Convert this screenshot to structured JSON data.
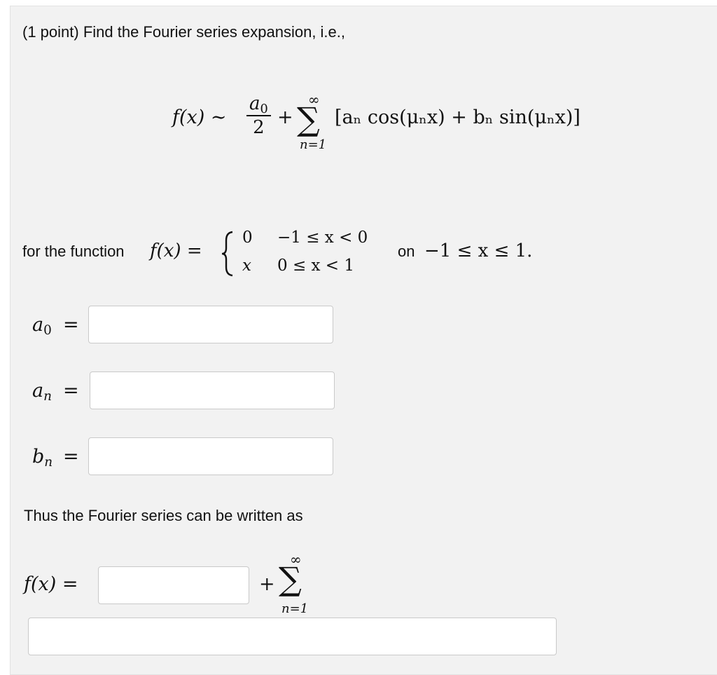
{
  "intro": "(1 point) Find the Fourier series expansion, i.e.,",
  "series_formula": {
    "lhs": "f(x) ∼",
    "frac_num": "a0",
    "frac_den": "2",
    "plus": "+",
    "sigma": "∑",
    "upper": "∞",
    "lower": "n=1",
    "term": "[aₙ cos(μₙx) + bₙ sin(μₙx)]"
  },
  "function_def": {
    "prefix": "for the function",
    "lhs": "f(x) =",
    "case1_value": "0",
    "case1_cond": "−1 ≤ x < 0",
    "case2_value": "x",
    "case2_cond": "0 ≤ x < 1",
    "suffix": "on",
    "domain": "−1 ≤ x ≤ 1."
  },
  "coefficients": [
    {
      "label": "a0",
      "eq": "=",
      "value": ""
    },
    {
      "label": "an",
      "eq": "=",
      "value": ""
    },
    {
      "label": "bn",
      "eq": "=",
      "value": ""
    }
  ],
  "thus_text": "Thus the Fourier series can be written as",
  "final_formula": {
    "lhs": "f(x) =",
    "plus": "+",
    "sigma": "∑",
    "upper": "∞",
    "lower": "n=1",
    "first_value": "",
    "sum_value": ""
  }
}
